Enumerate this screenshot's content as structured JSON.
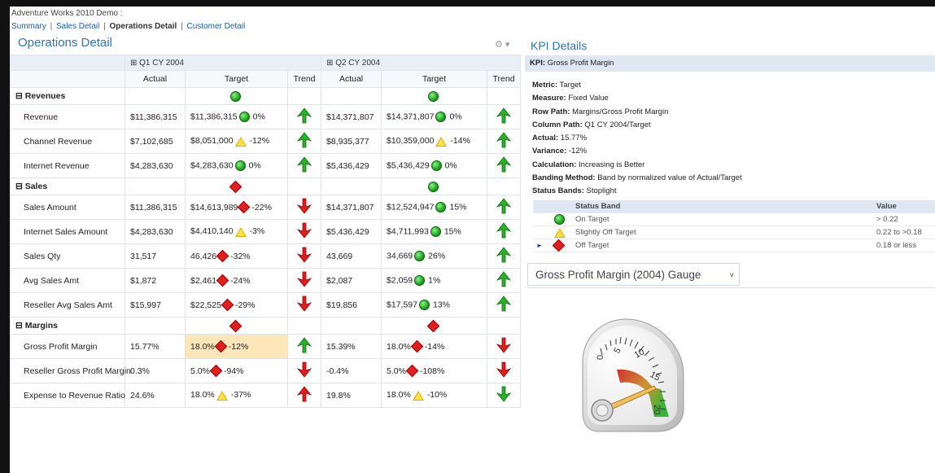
{
  "breadcrumb": "Adventure Works 2010 Demo :",
  "nav": {
    "links": [
      "Summary",
      "Sales Detail"
    ],
    "current": "Operations Detail",
    "last_link": "Customer Detail",
    "separator": "|"
  },
  "panel": {
    "title": "Operations Detail",
    "gear_icon": "gear-icon",
    "dropdown_glyph": "▾"
  },
  "grid": {
    "period_headers": [
      "⊞ Q1 CY 2004",
      "⊞ Q2 CY 2004"
    ],
    "column_headers": [
      "Actual",
      "Target",
      "Trend",
      "Actual",
      "Target",
      "Trend"
    ],
    "sections": [
      {
        "label": "⊟ Revenues",
        "status_q1": "green-circle",
        "status_q2": "green-circle",
        "rows": [
          {
            "label": "Revenue",
            "q1_actual": "$11,386,315",
            "q1_target": "$11,386,315",
            "q1_ind": "circle",
            "q1_pct": "0%",
            "q1_trend": "up-green",
            "q2_actual": "$14,371,807",
            "q2_target": "$14,371,807",
            "q2_ind": "circle",
            "q2_pct": "0%",
            "q2_trend": "up-green"
          },
          {
            "label": "Channel Revenue",
            "q1_actual": "$7,102,685",
            "q1_target": "$8,051,000",
            "q1_ind": "triangle",
            "q1_pct": "-12%",
            "q1_trend": "up-green",
            "q2_actual": "$8,935,377",
            "q2_target": "$10,359,000",
            "q2_ind": "triangle",
            "q2_pct": "-14%",
            "q2_trend": "up-green"
          },
          {
            "label": "Internet Revenue",
            "q1_actual": "$4,283,630",
            "q1_target": "$4,283,630",
            "q1_ind": "circle",
            "q1_pct": "0%",
            "q1_trend": "up-green",
            "q2_actual": "$5,436,429",
            "q2_target": "$5,436,429",
            "q2_ind": "circle",
            "q2_pct": "0%",
            "q2_trend": "up-green"
          }
        ]
      },
      {
        "label": "⊟ Sales",
        "status_q1": "red-diamond",
        "status_q2": "green-circle",
        "rows": [
          {
            "label": "Sales Amount",
            "q1_actual": "$11,386,315",
            "q1_target": "$14,613,989",
            "q1_ind": "diamond",
            "q1_pct": "-22%",
            "q1_trend": "down-red",
            "q2_actual": "$14,371,807",
            "q2_target": "$12,524,947",
            "q2_ind": "circle",
            "q2_pct": "15%",
            "q2_trend": "up-green"
          },
          {
            "label": "Internet Sales Amount",
            "q1_actual": "$4,283,630",
            "q1_target": "$4,410,140",
            "q1_ind": "triangle",
            "q1_pct": "-3%",
            "q1_trend": "down-red",
            "q2_actual": "$5,436,429",
            "q2_target": "$4,711,993",
            "q2_ind": "circle",
            "q2_pct": "15%",
            "q2_trend": "up-green"
          },
          {
            "label": "Sales Qty",
            "q1_actual": "31,517",
            "q1_target": "46,426",
            "q1_ind": "diamond",
            "q1_pct": "-32%",
            "q1_trend": "down-red",
            "q2_actual": "43,669",
            "q2_target": "34,669",
            "q2_ind": "circle",
            "q2_pct": "26%",
            "q2_trend": "up-green"
          },
          {
            "label": "Avg Sales Amt",
            "q1_actual": "$1,872",
            "q1_target": "$2,461",
            "q1_ind": "diamond",
            "q1_pct": "-24%",
            "q1_trend": "down-red",
            "q2_actual": "$2,087",
            "q2_target": "$2,059",
            "q2_ind": "circle",
            "q2_pct": "1%",
            "q2_trend": "up-green"
          },
          {
            "label": "Reseller Avg Sales Amt",
            "q1_actual": "$15,997",
            "q1_target": "$22,525",
            "q1_ind": "diamond",
            "q1_pct": "-29%",
            "q1_trend": "down-red",
            "q2_actual": "$19,856",
            "q2_target": "$17,597",
            "q2_ind": "circle",
            "q2_pct": "13%",
            "q2_trend": "up-green"
          }
        ]
      },
      {
        "label": "⊟ Margins",
        "status_q1": "red-diamond",
        "status_q2": "red-diamond",
        "rows": [
          {
            "label": "Gross Profit Margin",
            "q1_actual": "15.77%",
            "q1_target": "18.0%",
            "q1_ind": "diamond",
            "q1_pct": "-12%",
            "q1_trend": "up-green",
            "q2_actual": "15.39%",
            "q2_target": "18.0%",
            "q2_ind": "diamond",
            "q2_pct": "-14%",
            "q2_trend": "down-red",
            "selected": true
          },
          {
            "label": "Reseller Gross Profit Margin",
            "q1_actual": "0.3%",
            "q1_target": "5.0%",
            "q1_ind": "diamond",
            "q1_pct": "-94%",
            "q1_trend": "down-red",
            "q2_actual": "-0.4%",
            "q2_target": "5.0%",
            "q2_ind": "diamond",
            "q2_pct": "-108%",
            "q2_trend": "down-red"
          },
          {
            "label": "Expense to Revenue Ratio",
            "q1_actual": "24.6%",
            "q1_target": "18.0%",
            "q1_ind": "triangle",
            "q1_pct": "-37%",
            "q1_trend": "up-red",
            "q2_actual": "19.8%",
            "q2_target": "18.0%",
            "q2_ind": "triangle",
            "q2_pct": "-10%",
            "q2_trend": "down-green"
          }
        ]
      }
    ]
  },
  "kpi": {
    "title": "KPI Details",
    "header_label": "KPI:",
    "header_value": "Gross Profit Margin",
    "lines": [
      {
        "k": "Metric:",
        "v": "Target"
      },
      {
        "k": "Measure:",
        "v": "Fixed Value"
      },
      {
        "k": "Row Path:",
        "v": "Margins/Gross Profit Margin"
      },
      {
        "k": "Column Path:",
        "v": "Q1 CY 2004/Target"
      },
      {
        "k": "Actual:",
        "v": "15.77%"
      },
      {
        "k": "Variance:",
        "v": "-12%"
      },
      {
        "k": "Calculation:",
        "v": "Increasing is Better"
      },
      {
        "k": "Banding Method:",
        "v": "Band by normalized value of Actual/Target"
      },
      {
        "k": "Status Bands:",
        "v": "Stoplight"
      }
    ],
    "bands_header": {
      "band": "Status Band",
      "value": "Value"
    },
    "bands": [
      {
        "indicator": "circle",
        "label": "On Target",
        "value": "> 0.22",
        "selected": false
      },
      {
        "indicator": "triangle",
        "label": "Slightly Off Target",
        "value": "0.22 to >0.18",
        "selected": false
      },
      {
        "indicator": "diamond",
        "label": "Off Target",
        "value": "0.18 or less",
        "selected": true
      }
    ],
    "row_marker": "►"
  },
  "gauge": {
    "selector_label": "Gross Profit Margin (2004) Gauge",
    "chevron": "˅",
    "scale_labels": [
      "0",
      "5",
      "10",
      "15",
      "20"
    ],
    "needle_value": 15.77
  },
  "colors": {
    "accent": "#2f73b8",
    "link": "#1a5ea9",
    "highlight": "#fde7b9",
    "green": "#1ea51e",
    "red": "#e02020",
    "yellow": "#ffe24a"
  }
}
